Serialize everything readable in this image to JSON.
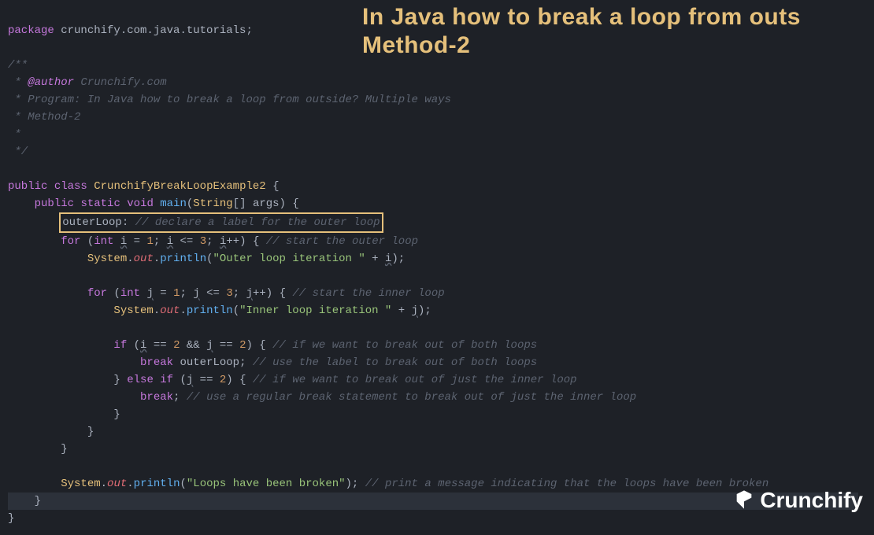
{
  "overlay": {
    "line1": "In Java how to break a loop from outs",
    "line2": "Method-2"
  },
  "code": {
    "kw_package": "package",
    "package_name": " crunchify.com.java.tutorials;",
    "c_open": "/**",
    "c_star": " * ",
    "c_star_only": " *",
    "c_author_tag": "@author",
    "c_author_val": " Crunchify.com",
    "c_program": "Program: In Java how to break a loop from outside? Multiple ways",
    "c_method": "Method-2",
    "c_close": " */",
    "kw_public": "public",
    "kw_class": "class",
    "class_name": "CrunchifyBreakLoopExample2",
    "kw_static": "static",
    "kw_void": "void",
    "m_main": "main",
    "t_string": "String",
    "p_args": "args",
    "label_outer": "outerLoop:",
    "c_label": "// declare a label for the outer loop",
    "kw_for": "for",
    "kw_int": "int",
    "v_i": "i",
    "v_j": "j",
    "n1": "1",
    "n2": "2",
    "n3": "3",
    "c_outer": "// start the outer loop",
    "sys": "System",
    "out": "out",
    "println": "println",
    "s_outer": "\"Outer loop iteration \"",
    "s_inner": "\"Inner loop iteration \"",
    "c_inner": "// start the inner loop",
    "kw_if": "if",
    "kw_else": "else",
    "kw_break": "break",
    "label_ref": "outerLoop",
    "c_both": "// if we want to break out of both loops",
    "c_use_label": "// use the label to break out of both loops",
    "c_just_inner": "// if we want to break out of just the inner loop",
    "c_reg_break": "// use a regular break statement to break out of just the inner loop",
    "s_broken": "\"Loops have been broken\"",
    "c_broken": "// print a message indicating that the loops have been broken"
  },
  "brand": "Crunchify"
}
